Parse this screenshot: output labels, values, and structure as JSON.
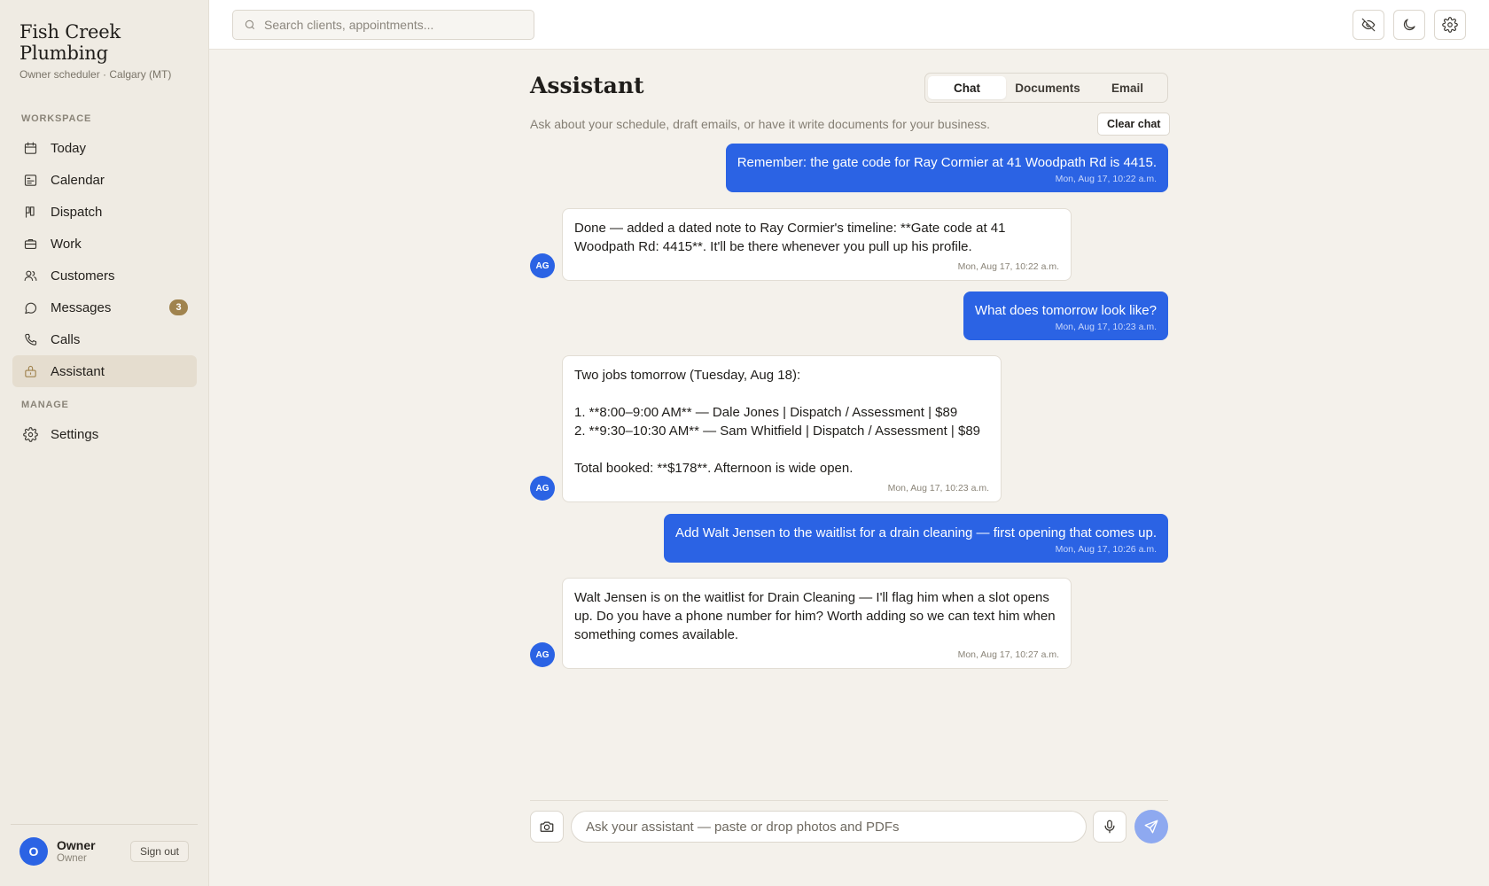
{
  "brand": {
    "name": "Fish Creek Plumbing",
    "sub": "Owner scheduler · Calgary (MT)"
  },
  "sidebar": {
    "workspace_label": "WORKSPACE",
    "manage_label": "MANAGE",
    "items": [
      {
        "label": "Today",
        "icon": "calendar-icon"
      },
      {
        "label": "Calendar",
        "icon": "calendar-grid-icon"
      },
      {
        "label": "Dispatch",
        "icon": "board-icon"
      },
      {
        "label": "Work",
        "icon": "briefcase-icon"
      },
      {
        "label": "Customers",
        "icon": "users-icon"
      },
      {
        "label": "Messages",
        "icon": "chat-bubble-icon",
        "badge": "3"
      },
      {
        "label": "Calls",
        "icon": "phone-icon"
      },
      {
        "label": "Assistant",
        "icon": "assistant-icon",
        "active": true
      }
    ],
    "manage_items": [
      {
        "label": "Settings",
        "icon": "gear-icon"
      }
    ],
    "footer": {
      "avatar": "O",
      "name": "Owner",
      "role": "Owner",
      "signout": "Sign out"
    }
  },
  "topbar": {
    "search_placeholder": "Search clients, appointments..."
  },
  "main": {
    "title": "Assistant",
    "tabs": [
      {
        "label": "Chat",
        "active": true
      },
      {
        "label": "Documents"
      },
      {
        "label": "Email"
      }
    ],
    "subtitle": "Ask about your schedule, draft emails, or have it write documents for your business.",
    "clear_label": "Clear chat",
    "bot_avatar": "AG",
    "messages": [
      {
        "role": "user",
        "text": "Remember: the gate code for Ray Cormier at 41 Woodpath Rd is 4415.",
        "time": "Mon, Aug 17, 10:22 a.m."
      },
      {
        "role": "assistant",
        "text": "Done — added a dated note to Ray Cormier's timeline: **Gate code at 41\nWoodpath Rd: 4415**. It'll be there whenever you pull up his profile.",
        "time": "Mon, Aug 17, 10:22 a.m."
      },
      {
        "role": "user",
        "text": "What does tomorrow look like?",
        "time": "Mon, Aug 17, 10:23 a.m."
      },
      {
        "role": "assistant",
        "text": "Two jobs tomorrow (Tuesday, Aug 18):\n\n1. **8:00–9:00 AM** — Dale Jones | Dispatch / Assessment | $89\n2. **9:30–10:30 AM** — Sam Whitfield | Dispatch / Assessment | $89\n\nTotal booked: **$178**. Afternoon is wide open.",
        "time": "Mon, Aug 17, 10:23 a.m."
      },
      {
        "role": "user",
        "text": "Add Walt Jensen to the waitlist for a drain cleaning — first opening that comes up.",
        "time": "Mon, Aug 17, 10:26 a.m."
      },
      {
        "role": "assistant",
        "text": "Walt Jensen is on the waitlist for Drain Cleaning — I'll flag him when a slot opens\nup. Do you have a phone number for him? Worth adding so we can text him when\nsomething comes available.",
        "time": "Mon, Aug 17, 10:27 a.m."
      }
    ],
    "composer_placeholder": "Ask your assistant — paste or drop photos and PDFs"
  },
  "colors": {
    "accent": "#2b63e4",
    "badge": "#a0834e",
    "background": "#f4f1eb",
    "sidebar": "#efebe3"
  }
}
